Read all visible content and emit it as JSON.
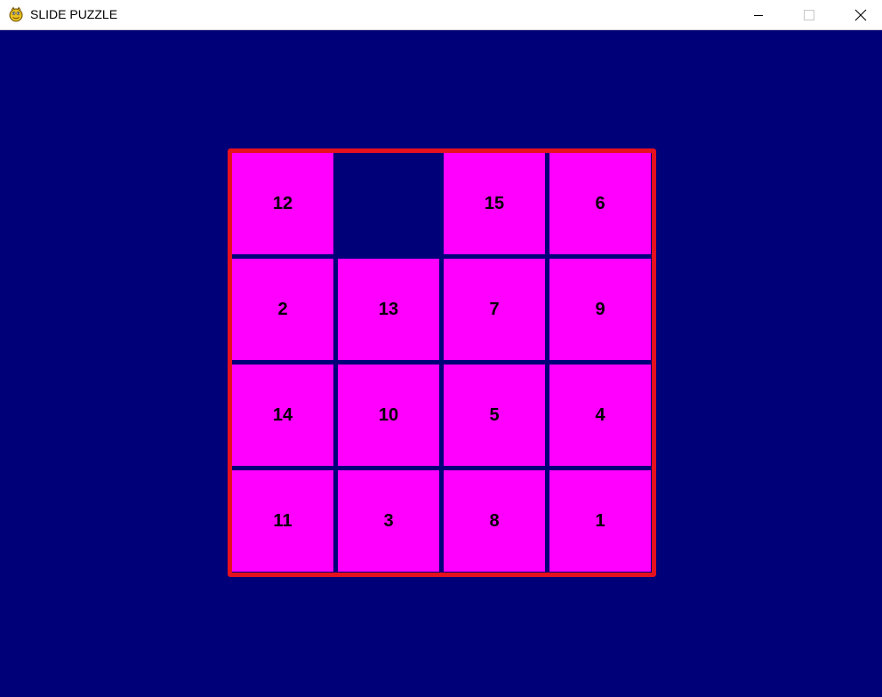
{
  "window": {
    "title": "SLIDE PUZZLE",
    "icon": "pygame-snake-icon",
    "controls": [
      "minimize-icon",
      "maximize-icon",
      "close-icon"
    ]
  },
  "colors": {
    "background": "#000078",
    "tile": "#ff00ff",
    "tile_text": "#000000",
    "border": "#e6101e"
  },
  "board": {
    "size": 4,
    "rows": [
      [
        "12",
        "",
        "15",
        "6"
      ],
      [
        "2",
        "13",
        "7",
        "9"
      ],
      [
        "14",
        "10",
        "5",
        "4"
      ],
      [
        "11",
        "3",
        "8",
        "1"
      ]
    ]
  }
}
